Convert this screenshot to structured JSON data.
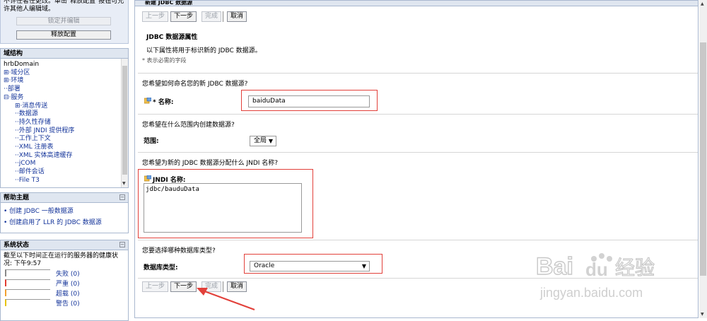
{
  "lock_panel": {
    "notice": "不许任者任更改。单击\"释放配置\"按钮可允许其他人编辑域。",
    "lock_button": "锁定并编辑",
    "release_button": "释放配置"
  },
  "domain_structure": {
    "title": "域结构",
    "items": [
      {
        "label": "hrbDomain"
      },
      {
        "label": "⊞·域分区"
      },
      {
        "label": "⊞·环境"
      },
      {
        "label": "··部署"
      },
      {
        "label": "⊟·服务"
      },
      {
        "label": "⊞·消息传送"
      },
      {
        "label": "··数据源"
      },
      {
        "label": "··持久性存储"
      },
      {
        "label": "··外部 JNDI 提供程序"
      },
      {
        "label": "··工作上下文"
      },
      {
        "label": "··XML 注册表"
      },
      {
        "label": "··XML 实体高速缓存"
      },
      {
        "label": "··jCOM"
      },
      {
        "label": "··邮件会话"
      },
      {
        "label": "··File T3"
      }
    ]
  },
  "help": {
    "title": "帮助主题",
    "items": [
      "创建 JDBC 一般数据源",
      "创建启用了 LLR 的 JDBC 数据源"
    ]
  },
  "system_status": {
    "title": "系统状态",
    "desc": "截至以下时间正在运行的服务器的健康状况: 下午9:57",
    "rows": [
      {
        "label": "失败 (0)",
        "color": "#888888"
      },
      {
        "label": "严重 (0)",
        "color": "#e03c31"
      },
      {
        "label": "超载 (0)",
        "color": "#f0a030"
      },
      {
        "label": "警告 (0)",
        "color": "#e6c300"
      }
    ]
  },
  "wizard": {
    "title": "新建 JDBC 数据源",
    "buttons": {
      "back": "上一步",
      "next": "下一步",
      "finish": "完成",
      "cancel": "取消"
    },
    "section_title": "JDBC 数据源属性",
    "section_desc": "以下属性将用于标识新的 JDBC 数据源。",
    "required_note": "* 表示必需的字段",
    "q_name": "您希望如何命名您的新 JDBC 数据源?",
    "name_label": "* 名称:",
    "name_value": "baiduData",
    "q_scope": "您希望在什么范围内创建数据源?",
    "scope_label": "范围:",
    "scope_value": "全局",
    "q_jndi": "您希望为新的 JDBC 数据源分配什么 JNDI 名称?",
    "jndi_label": "JNDI 名称:",
    "jndi_value": "jdbc/bauduData",
    "q_dbtype": "您要选择哪种数据库类型?",
    "dbtype_label": "数据库类型:",
    "dbtype_value": "Oracle"
  },
  "watermark": {
    "brand": "Bai",
    "brand2": "du",
    "cn": "经验",
    "url": "jingyan.baidu.com"
  },
  "colors": {
    "annotation_red": "#e2403a",
    "link": "#14349a",
    "panel_header": "#dfe6f0"
  }
}
